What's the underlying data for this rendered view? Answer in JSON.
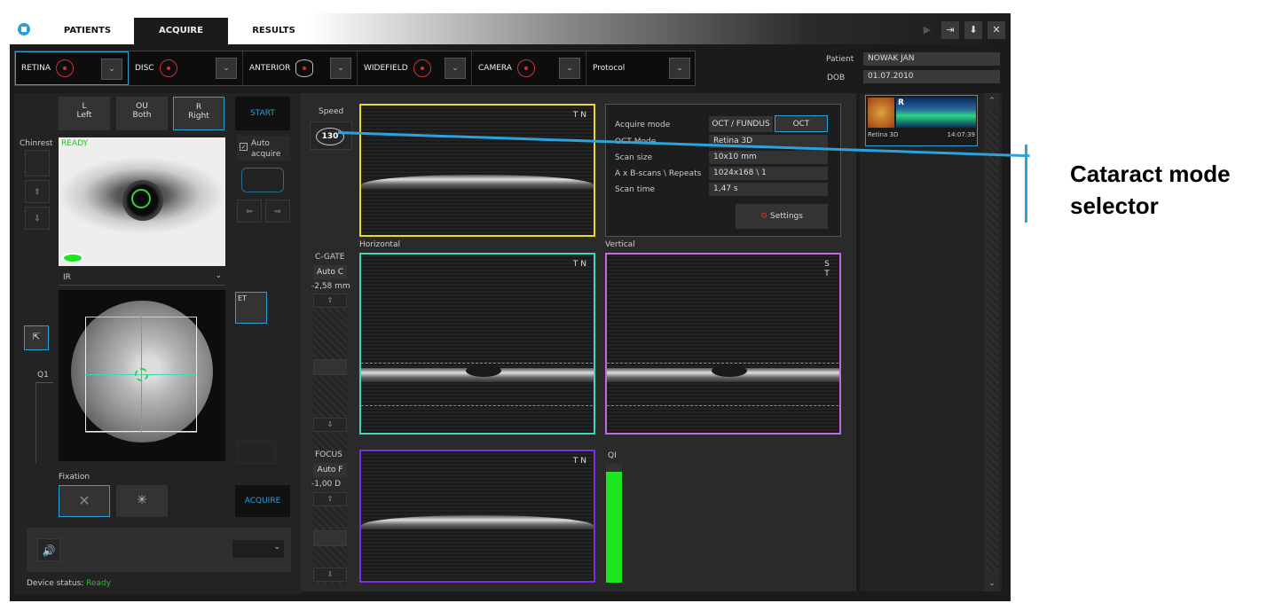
{
  "tabs": {
    "patients": "PATIENTS",
    "acquire": "ACQUIRE",
    "results": "RESULTS"
  },
  "modes": [
    {
      "label": "RETINA",
      "sup": "R"
    },
    {
      "label": "DISC",
      "sup": "D"
    },
    {
      "label": "ANTERIOR",
      "sup": "A"
    },
    {
      "label": "WIDEFIELD",
      "sup": "W"
    },
    {
      "label": "CAMERA",
      "sup": "FC C"
    },
    {
      "label": "Protocol",
      "sup": ""
    }
  ],
  "patient": {
    "patient_label": "Patient",
    "name": "NOWAK JAN",
    "dob_label": "DOB",
    "dob": "01.07.2010"
  },
  "eye": {
    "l": "L",
    "l_sub": "Left",
    "ou": "OU",
    "ou_sub": "Both",
    "r": "R",
    "r_sub": "Right"
  },
  "start": "START",
  "auto_acquire": "Auto acquire",
  "chinrest": "Chinrest",
  "ready": "READY",
  "ir_select": "IR",
  "q1_label": "Q1",
  "fixation": "Fixation",
  "acquire_btn": "ACQUIRE",
  "device_status_label": "Device status:",
  "device_status_value": "Ready",
  "speed": {
    "label": "Speed",
    "value": "130"
  },
  "cgate": {
    "label": "C-GATE",
    "auto": "Auto C",
    "value": "-2,58 mm"
  },
  "focus": {
    "label": "FOCUS",
    "auto": "Auto F",
    "value": "-1,00 D"
  },
  "scan_labels": {
    "horizontal": "Horizontal",
    "vertical": "Vertical",
    "tn": "T N",
    "st": "S T",
    "qi": "QI"
  },
  "info": {
    "acquire_mode": "Acquire mode",
    "opt1": "OCT / FUNDUS",
    "opt2": "OCT",
    "rows": [
      {
        "k": "OCT Mode",
        "v": "Retina 3D"
      },
      {
        "k": "Scan size",
        "v": "10x10 mm"
      },
      {
        "k": "A x B-scans \\ Repeats",
        "v": "1024x168 \\ 1"
      },
      {
        "k": "Scan time",
        "v": "1,47 s"
      }
    ],
    "settings": "Settings"
  },
  "thumb": {
    "eye": "R",
    "name": "Retina 3D",
    "time": "14:07:39"
  },
  "annotation": {
    "line1": "Cataract mode",
    "line2": "selector"
  },
  "colors": {
    "accent": "#2a9fd8",
    "yellow": "#e6dc22",
    "teal": "#3dd8b8",
    "purple": "#c06be0",
    "violet": "#7a2fe0",
    "green": "#1ee61e"
  }
}
